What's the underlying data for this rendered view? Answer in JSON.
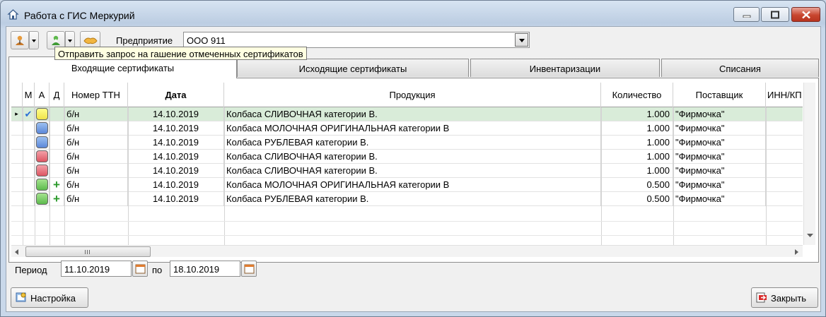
{
  "window": {
    "title": "Работа с ГИС Меркурий",
    "controls": [
      "minimize",
      "maximize",
      "close"
    ]
  },
  "toolbar": {
    "enterprise_label": "Предприятие",
    "enterprise_value": "ООО 911",
    "tooltip": "Отправить запрос на гашение отмеченных сертификатов"
  },
  "tabs": [
    {
      "label": "Входящие сертификаты",
      "active": true
    },
    {
      "label": "Исходящие сертификаты",
      "active": false
    },
    {
      "label": "Инвентаризации",
      "active": false
    },
    {
      "label": "Списания",
      "active": false
    }
  ],
  "grid": {
    "columns": [
      "М",
      "А",
      "Д",
      "Номер ТТН",
      "Дата",
      "Продукция",
      "Количество",
      "Поставщик",
      "ИНН/КП"
    ],
    "rows": [
      {
        "m": "✔",
        "a": "yellow",
        "d": "",
        "ttn": "б/н",
        "date": "14.10.2019",
        "product": "Колбаса  СЛИВОЧНАЯ категории В.",
        "qty": "1.000",
        "supplier": "\"Фирмочка\"",
        "selected": true
      },
      {
        "m": "",
        "a": "blue",
        "d": "",
        "ttn": "б/н",
        "date": "14.10.2019",
        "product": "Колбаса МОЛОЧНАЯ ОРИГИНАЛЬНАЯ категории В",
        "qty": "1.000",
        "supplier": "\"Фирмочка\"",
        "selected": false
      },
      {
        "m": "",
        "a": "blue",
        "d": "",
        "ttn": "б/н",
        "date": "14.10.2019",
        "product": "Колбаса РУБЛЕВАЯ категории В.",
        "qty": "1.000",
        "supplier": "\"Фирмочка\"",
        "selected": false
      },
      {
        "m": "",
        "a": "red",
        "d": "",
        "ttn": "б/н",
        "date": "14.10.2019",
        "product": "Колбаса  СЛИВОЧНАЯ категории В.",
        "qty": "1.000",
        "supplier": "\"Фирмочка\"",
        "selected": false
      },
      {
        "m": "",
        "a": "red",
        "d": "",
        "ttn": "б/н",
        "date": "14.10.2019",
        "product": "Колбаса  СЛИВОЧНАЯ категории В.",
        "qty": "1.000",
        "supplier": "\"Фирмочка\"",
        "selected": false
      },
      {
        "m": "",
        "a": "green",
        "d": "+",
        "ttn": "б/н",
        "date": "14.10.2019",
        "product": "Колбаса МОЛОЧНАЯ ОРИГИНАЛЬНАЯ категории В",
        "qty": "0.500",
        "supplier": "\"Фирмочка\"",
        "selected": false
      },
      {
        "m": "",
        "a": "green",
        "d": "+",
        "ttn": "б/н",
        "date": "14.10.2019",
        "product": "Колбаса РУБЛЕВАЯ категории В.",
        "qty": "0.500",
        "supplier": "\"Фирмочка\"",
        "selected": false
      }
    ],
    "row_indicator": "▸"
  },
  "period": {
    "label": "Период",
    "from": "11.10.2019",
    "to_label": "по",
    "to": "18.10.2019"
  },
  "footer": {
    "settings_label": "Настройка",
    "close_label": "Закрыть"
  }
}
